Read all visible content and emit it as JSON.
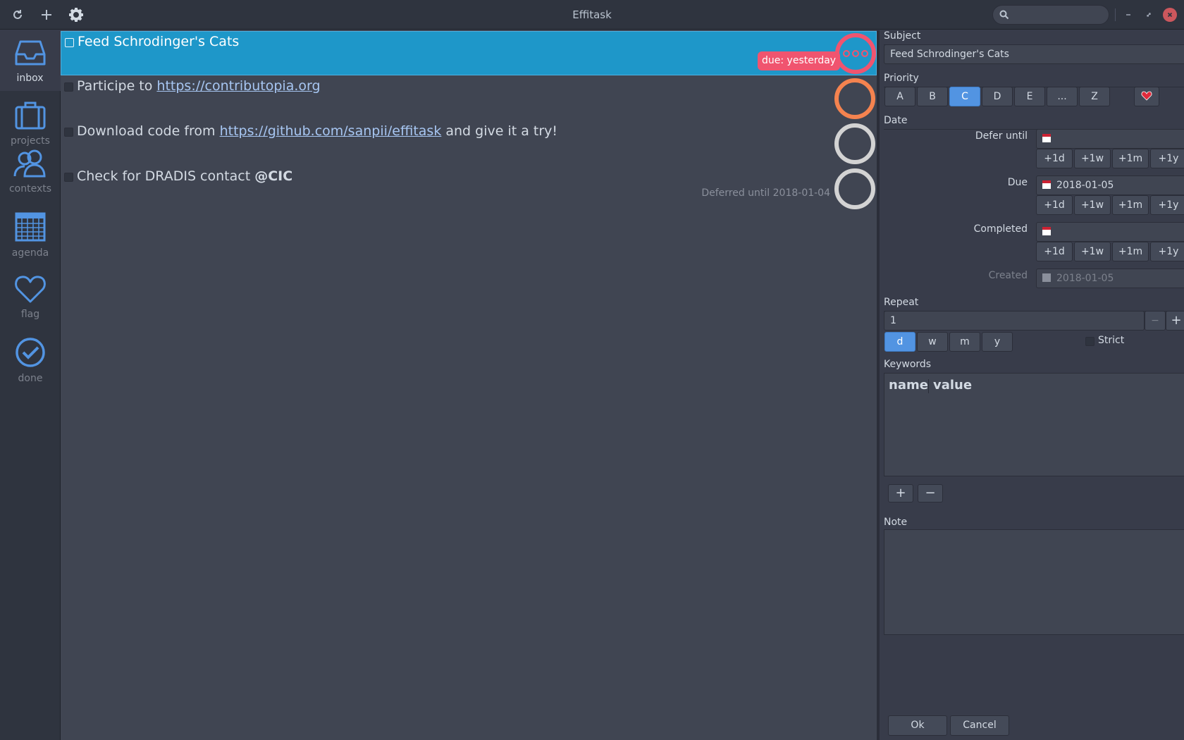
{
  "header": {
    "title": "Effitask",
    "search_placeholder": "",
    "icons": [
      "refresh-icon",
      "add-icon",
      "gear-icon",
      "search-icon",
      "minimize-icon",
      "maximize-icon",
      "close-icon"
    ]
  },
  "sidebar": {
    "items": [
      {
        "label": "inbox",
        "icon": "inbox-icon",
        "active": true
      },
      {
        "label": "projects",
        "icon": "briefcase-icon",
        "active": false
      },
      {
        "label": "contexts",
        "icon": "people-icon",
        "active": false
      },
      {
        "label": "agenda",
        "icon": "calendar-icon",
        "active": false
      },
      {
        "label": "flag",
        "icon": "heart-icon",
        "active": false
      },
      {
        "label": "done",
        "icon": "check-circle-icon",
        "active": false
      }
    ]
  },
  "tasks": [
    {
      "text": "Feed Schrodinger's Cats",
      "badge": "due: yesterday",
      "ring": "red",
      "selected": true
    },
    {
      "prefix": "Participe to ",
      "link": "https://contributopia.org",
      "ring": "orange"
    },
    {
      "prefix": "Download code from ",
      "link": "https://github.com/sanpii/effitask",
      "suffix": " and give it a try!",
      "ring": "grey"
    },
    {
      "prefix": "Check for DRADIS contact ",
      "bold": "@CIC",
      "deferred": "Deferred until 2018-01-04",
      "ring": "grey"
    }
  ],
  "detail": {
    "subject_label": "Subject",
    "subject_value": "Feed Schrodinger's Cats",
    "priority_label": "Priority",
    "priorities": [
      "A",
      "B",
      "C",
      "D",
      "E",
      "...",
      "Z"
    ],
    "priority_selected": "C",
    "flag_icon": "heart-icon",
    "date_label": "Date",
    "defer_label": "Defer until",
    "defer_value": "",
    "due_label": "Due",
    "due_value": "2018-01-05",
    "completed_label": "Completed",
    "completed_value": "",
    "created_label": "Created",
    "created_value": "2018-01-05",
    "increments": [
      "+1d",
      "+1w",
      "+1m",
      "+1y"
    ],
    "repeat_label": "Repeat",
    "repeat_value": "1",
    "repeat_minus": "−",
    "repeat_plus": "+",
    "repeat_units": [
      "d",
      "w",
      "m",
      "y"
    ],
    "repeat_unit_selected": "d",
    "strict_label": "Strict",
    "keywords_label": "Keywords",
    "kw_name": "name",
    "kw_value": "value",
    "kw_add": "+",
    "kw_remove": "−",
    "note_label": "Note",
    "ok_label": "Ok",
    "cancel_label": "Cancel"
  },
  "colors": {
    "accent": "#5294e2",
    "selected_row": "#1e97c9",
    "due_badge": "#f0546f",
    "ring_red": "#f0546f",
    "ring_orange": "#f5834f",
    "ring_grey": "#d3d3d3"
  }
}
